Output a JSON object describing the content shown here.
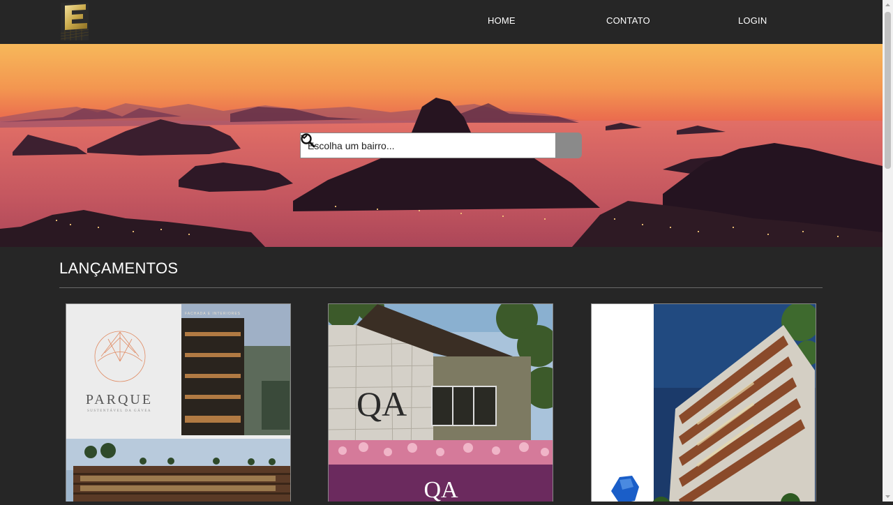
{
  "nav": {
    "home": "HOME",
    "contato": "CONTATO",
    "login": "LOGIN"
  },
  "search": {
    "selected": "Escolha um bairro..."
  },
  "section": {
    "title": "LANÇAMENTOS"
  },
  "cards": [
    {
      "brand": "PARQUE",
      "subtitle": "SUSTENTÁVEL DA GÁVEA",
      "caption": "FACHADA E INTERIORES"
    },
    {
      "brand": "QA",
      "label": "QA"
    },
    {
      "brand": ""
    }
  ],
  "colors": {
    "background": "#262626",
    "gold": "#c9a94a",
    "purple": "#6b2a5e",
    "scroll_thumb": "#c1c1c1"
  },
  "icons": {
    "logo": "E-logo",
    "search": "search-icon",
    "chevron": "chevron-down-icon"
  }
}
